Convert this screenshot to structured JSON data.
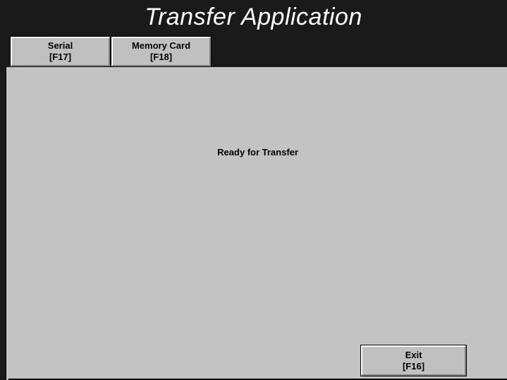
{
  "app": {
    "title": "Transfer Application"
  },
  "tabs": [
    {
      "label": "Serial",
      "key": "[F17]"
    },
    {
      "label": "Memory Card",
      "key": "[F18]"
    }
  ],
  "main": {
    "status": "Ready for Transfer"
  },
  "footer": {
    "exit_label": "Exit",
    "exit_key": "[F16]"
  },
  "colors": {
    "background_dark": "#1a1a1a",
    "panel_gray": "#c3c3c3",
    "button_gray": "#c0c0c0",
    "title_text": "#ffffff"
  }
}
